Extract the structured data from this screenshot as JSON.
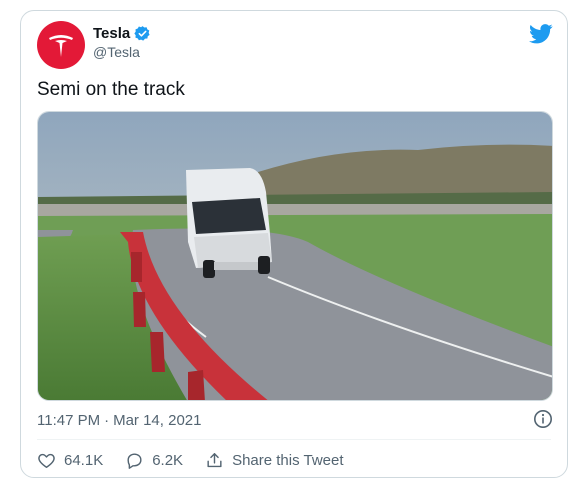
{
  "tweet": {
    "author_name": "Tesla",
    "handle": "@Tesla",
    "text": "Semi on the track",
    "time": "11:47 PM",
    "separator": "·",
    "date": "Mar 14, 2021"
  },
  "actions": {
    "likes": "64.1K",
    "replies": "6.2K",
    "share_label": "Share this Tweet"
  },
  "icons": {
    "avatar": "tesla-logo",
    "verified": "verified-badge-icon",
    "brand": "twitter-bird-icon",
    "info": "info-icon",
    "like": "heart-icon",
    "reply": "reply-bubble-icon",
    "share": "share-icon"
  },
  "colors": {
    "tesla_red": "#e31937",
    "twitter_blue": "#1d9bf0",
    "text_primary": "#0f1419",
    "text_secondary": "#536471"
  }
}
